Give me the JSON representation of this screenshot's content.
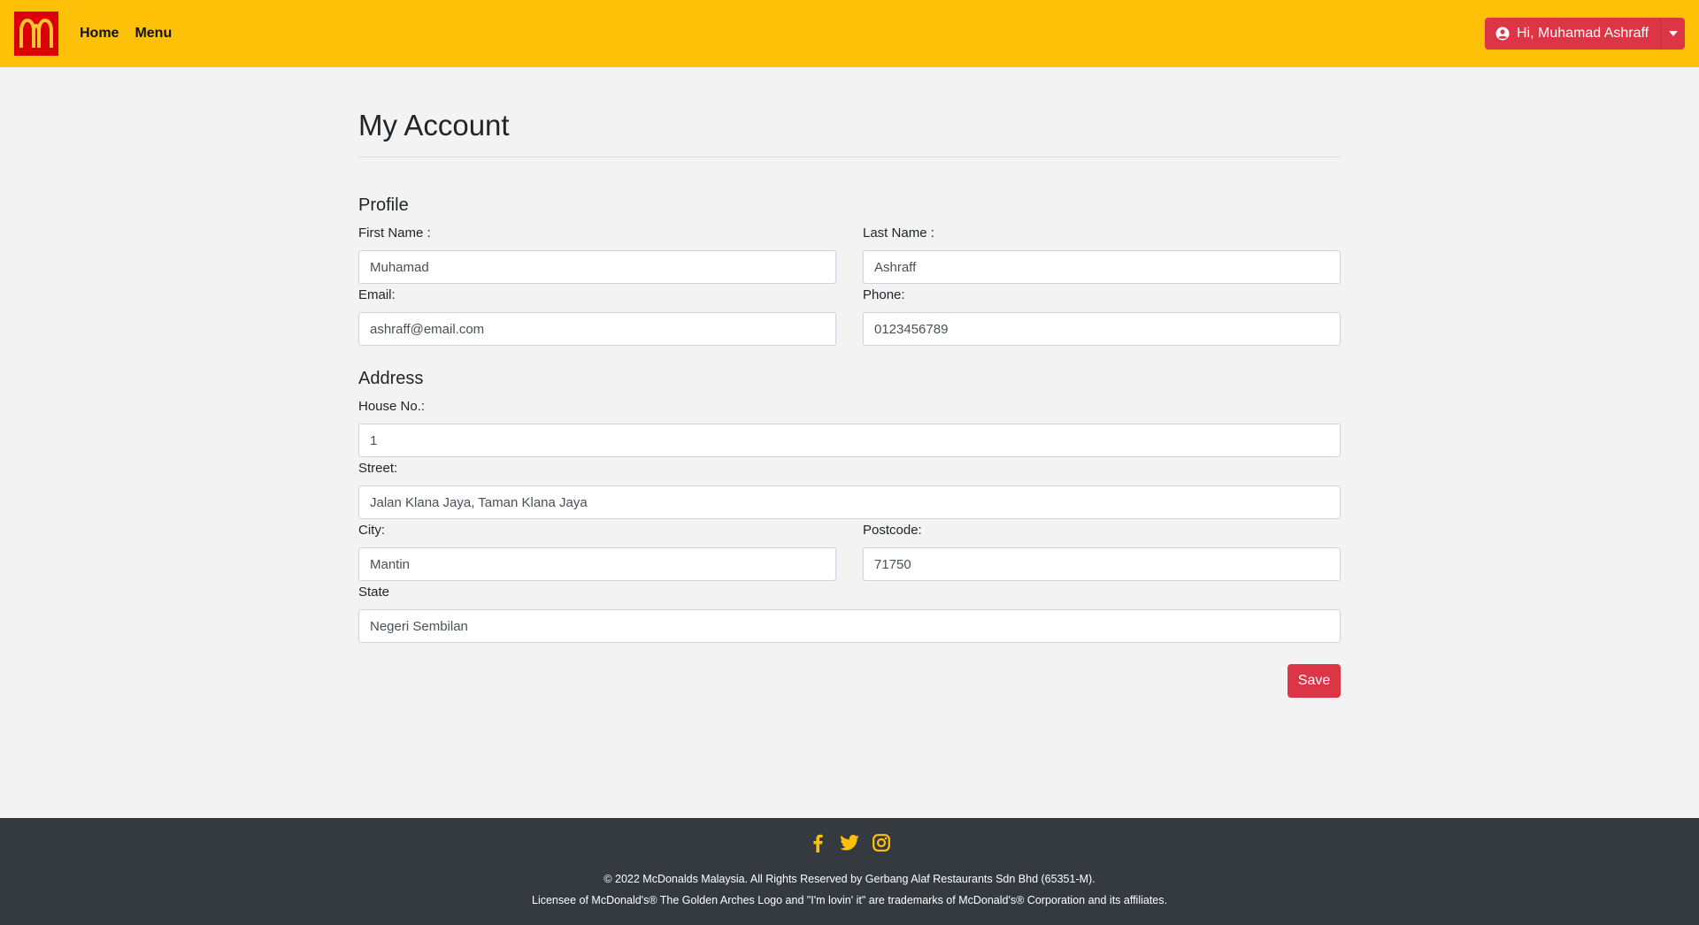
{
  "nav": {
    "home": "Home",
    "menu": "Menu",
    "user_greeting": "Hi, Muhamad Ashraff"
  },
  "page": {
    "title": "My Account"
  },
  "profile": {
    "heading": "Profile",
    "first_name_label": "First Name :",
    "first_name_value": "Muhamad",
    "last_name_label": "Last Name :",
    "last_name_value": "Ashraff",
    "email_label": "Email:",
    "email_value": "ashraff@email.com",
    "phone_label": "Phone:",
    "phone_value": "0123456789"
  },
  "address": {
    "heading": "Address",
    "house_label": "House No.:",
    "house_value": "1",
    "street_label": "Street:",
    "street_value": "Jalan Klana Jaya, Taman Klana Jaya",
    "city_label": "City:",
    "city_value": "Mantin",
    "postcode_label": "Postcode:",
    "postcode_value": "71750",
    "state_label": "State",
    "state_value": "Negeri Sembilan"
  },
  "actions": {
    "save": "Save"
  },
  "footer": {
    "copyright": "© 2022 McDonalds Malaysia. All Rights Reserved by Gerbang Alaf Restaurants Sdn Bhd (65351-M).",
    "license": "Licensee of McDonald's® The Golden Arches Logo and \"I'm lovin' it\" are trademarks of McDonald's® Corporation and its affiliates.",
    "icons": [
      "facebook-icon",
      "twitter-icon",
      "instagram-icon"
    ]
  },
  "colors": {
    "navbar": "#ffc107",
    "logo_bg": "#db0007",
    "logo_arches": "#ffc72c",
    "accent": "#dc3545",
    "footer_bg": "#343a40",
    "footer_icon": "#ffc107"
  }
}
